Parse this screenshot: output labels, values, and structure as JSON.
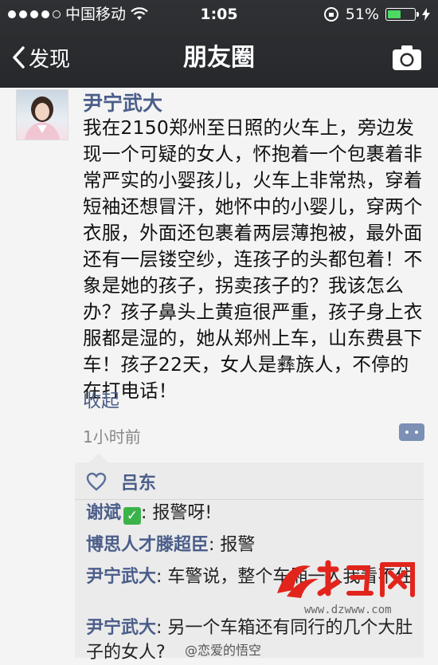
{
  "status_bar": {
    "carrier": "中国移动",
    "time": "1:05",
    "battery": "51%",
    "battery_level": 0.51
  },
  "nav": {
    "back_label": "发现",
    "title": "朋友圈"
  },
  "post": {
    "author": "尹宁武大",
    "text": "我在2150郑州至日照的火车上，旁边发现一个可疑的女人，怀抱着一个包裹着非常严实的小婴孩儿，火车上非常热，穿着短袖还想冒汗，她怀中的小婴儿，穿两个衣服，外面还包裹着两层薄抱被，最外面还有一层镂空纱，连孩子的头都包着！不象是她的孩子，拐卖孩子的？我该怎么办？孩子鼻头上黄疸很严重，孩子身上衣服都是湿的，她从郑州上车，山东费县下车！孩子22天，女人是彝族人，不停的在打电话！",
    "collapse_label": "收起",
    "time": "1小时前"
  },
  "likes": {
    "names": [
      "吕东"
    ]
  },
  "comments": [
    {
      "name": "谢斌",
      "text": ": 报警呀!"
    },
    {
      "name": "博思人才滕超臣",
      "text": ": 报警"
    },
    {
      "name": "尹宁武大",
      "text": ": 车警说，整个车厢一人我看不住"
    },
    {
      "name": "尹宁武大",
      "text": ": 另一个车箱还有同行的几个大肚子的女人?"
    }
  ],
  "watermark": {
    "logo": "大众网",
    "url": "www.dzwww.com",
    "credit": "@恋爱的悟空"
  }
}
